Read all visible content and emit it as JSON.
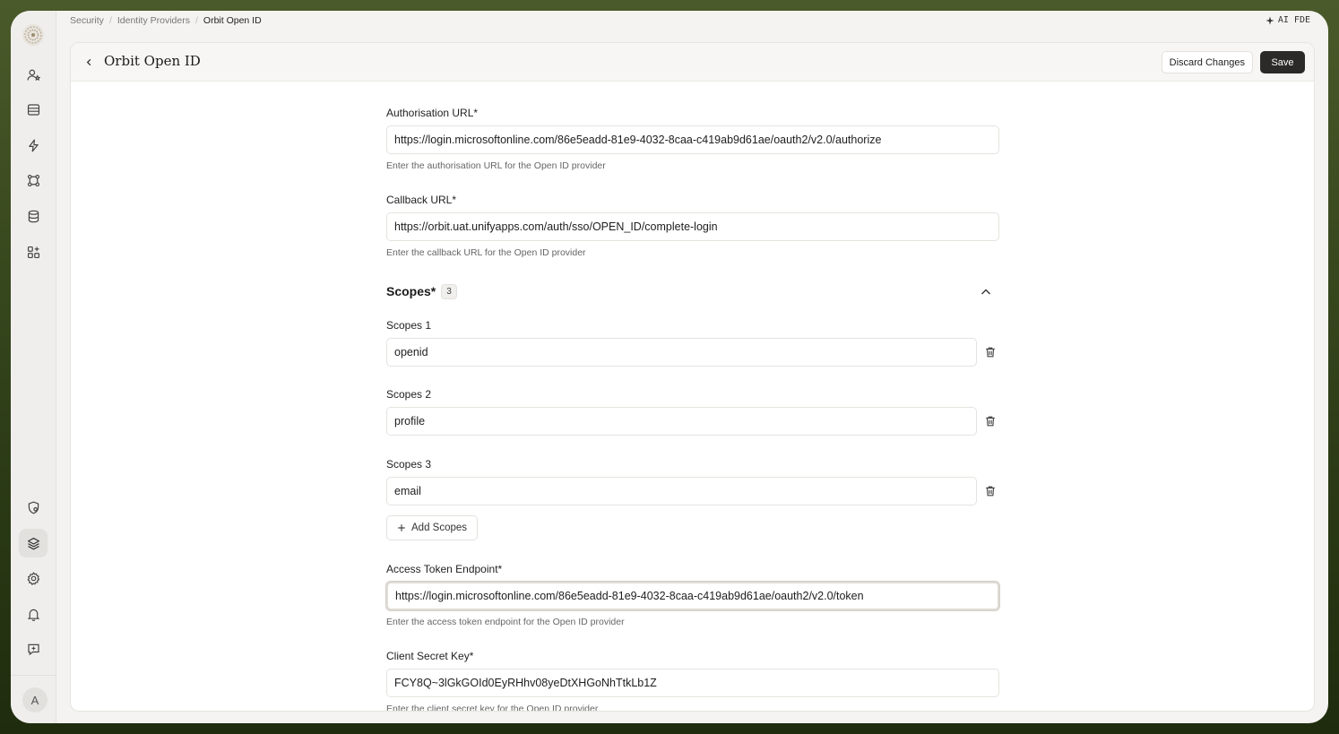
{
  "breadcrumb": [
    "Security",
    "Identity Providers",
    "Orbit Open ID"
  ],
  "ai_badge": "AI FDE",
  "avatar_initial": "A",
  "header": {
    "title": "Orbit Open ID",
    "discard_label": "Discard Changes",
    "save_label": "Save"
  },
  "form": {
    "auth_url": {
      "label": "Authorisation URL*",
      "value": "https://login.microsoftonline.com/86e5eadd-81e9-4032-8caa-c419ab9d61ae/oauth2/v2.0/authorize",
      "hint": "Enter the authorisation URL for the Open ID provider"
    },
    "callback_url": {
      "label": "Callback URL*",
      "value": "https://orbit.uat.unifyapps.com/auth/sso/OPEN_ID/complete-login",
      "hint": "Enter the callback URL for the Open ID provider"
    },
    "scopes": {
      "title": "Scopes*",
      "count": "3",
      "items": [
        {
          "label": "Scopes 1",
          "value": "openid"
        },
        {
          "label": "Scopes 2",
          "value": "profile"
        },
        {
          "label": "Scopes 3",
          "value": "email"
        }
      ],
      "add_label": "Add Scopes"
    },
    "token_endpoint": {
      "label": "Access Token Endpoint*",
      "value": "https://login.microsoftonline.com/86e5eadd-81e9-4032-8caa-c419ab9d61ae/oauth2/v2.0/token",
      "hint": "Enter the access token endpoint for the Open ID provider"
    },
    "client_secret": {
      "label": "Client Secret Key*",
      "value": "FCY8Q~3lGkGOId0EyRHhv08yeDtXHGoNhTtkLb1Z",
      "hint": "Enter the client secret key for the Open ID provider"
    }
  },
  "sidebar_icons": [
    "users-icon",
    "inbox-icon",
    "lightning-icon",
    "workflow-icon",
    "database-icon",
    "apps-icon",
    "shield-icon",
    "layers-icon",
    "gear-icon",
    "bell-icon",
    "chat-icon"
  ]
}
